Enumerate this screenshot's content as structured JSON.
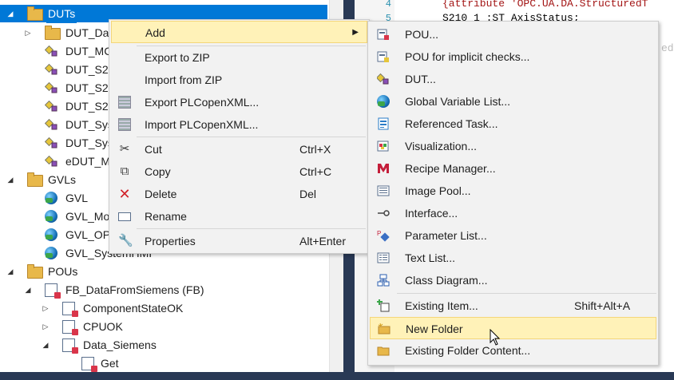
{
  "tree": {
    "items": [
      {
        "label": "DUTs",
        "indent": 0,
        "toggle": "◢",
        "icon": "folder-icon"
      },
      {
        "label": "DUT_Da",
        "indent": 1,
        "toggle": "▷",
        "icon": "folder-icon"
      },
      {
        "label": "DUT_MC",
        "indent": 1,
        "toggle": "",
        "icon": "dut-icon"
      },
      {
        "label": "DUT_S2",
        "indent": 1,
        "toggle": "",
        "icon": "dut-icon"
      },
      {
        "label": "DUT_S2",
        "indent": 1,
        "toggle": "",
        "icon": "dut-icon"
      },
      {
        "label": "DUT_S2",
        "indent": 1,
        "toggle": "",
        "icon": "dut-icon"
      },
      {
        "label": "DUT_Sys",
        "indent": 1,
        "toggle": "",
        "icon": "dut-icon"
      },
      {
        "label": "DUT_Sys",
        "indent": 1,
        "toggle": "",
        "icon": "dut-icon"
      },
      {
        "label": "eDUT_M",
        "indent": 1,
        "toggle": "",
        "icon": "dut-icon"
      },
      {
        "label": "GVLs",
        "indent": 0,
        "toggle": "◢",
        "icon": "folder-icon"
      },
      {
        "label": "GVL",
        "indent": 1,
        "toggle": "",
        "icon": "gvl-icon"
      },
      {
        "label": "GVL_Mo",
        "indent": 1,
        "toggle": "",
        "icon": "gvl-icon"
      },
      {
        "label": "GVL_OP",
        "indent": 1,
        "toggle": "",
        "icon": "gvl-icon"
      },
      {
        "label": "GVL_SystemHMI",
        "indent": 1,
        "toggle": "",
        "icon": "gvl-icon"
      },
      {
        "label": "POUs",
        "indent": 0,
        "toggle": "◢",
        "icon": "folder-icon"
      },
      {
        "label": "FB_DataFromSiemens (FB)",
        "indent": 1,
        "toggle": "◢",
        "icon": "pou-icon"
      },
      {
        "label": "ComponentStateOK",
        "indent": 2,
        "toggle": "▷",
        "icon": "pou-icon"
      },
      {
        "label": "CPUOK",
        "indent": 2,
        "toggle": "▷",
        "icon": "pou-icon"
      },
      {
        "label": "Data_Siemens",
        "indent": 2,
        "toggle": "◢",
        "icon": "pou-icon"
      },
      {
        "label": "Get",
        "indent": 3,
        "toggle": "",
        "icon": "pou-icon"
      }
    ]
  },
  "editor": {
    "line_numbers": [
      "4",
      "5"
    ],
    "lines": [
      "{attribute 'OPC.UA.DA.StructuredT",
      "S210_1  :ST_AxisStatus;"
    ],
    "fragment": "edT"
  },
  "context_menu": {
    "items": [
      {
        "label": "Add",
        "shortcut": "",
        "submenu": true,
        "icon": ""
      },
      {
        "label": "Export to ZIP",
        "shortcut": "",
        "icon": ""
      },
      {
        "label": "Import from ZIP",
        "shortcut": "",
        "icon": ""
      },
      {
        "label": "Export PLCopenXML...",
        "shortcut": "",
        "icon": "export-xml-icon"
      },
      {
        "label": "Import PLCopenXML...",
        "shortcut": "",
        "icon": "import-xml-icon"
      },
      {
        "label": "Cut",
        "shortcut": "Ctrl+X",
        "icon": "scissors-icon"
      },
      {
        "label": "Copy",
        "shortcut": "Ctrl+C",
        "icon": "copy-icon"
      },
      {
        "label": "Delete",
        "shortcut": "Del",
        "icon": "delete-icon"
      },
      {
        "label": "Rename",
        "shortcut": "",
        "icon": "rename-icon"
      },
      {
        "label": "Properties",
        "shortcut": "Alt+Enter",
        "icon": "wrench-icon"
      }
    ]
  },
  "add_submenu": {
    "items": [
      {
        "label": "POU...",
        "shortcut": "",
        "icon": "pou-icon"
      },
      {
        "label": "POU for implicit checks...",
        "shortcut": "",
        "icon": "pou-checks-icon"
      },
      {
        "label": "DUT...",
        "shortcut": "",
        "icon": "dut-icon"
      },
      {
        "label": "Global Variable List...",
        "shortcut": "",
        "icon": "globe-icon"
      },
      {
        "label": "Referenced Task...",
        "shortcut": "",
        "icon": "task-icon"
      },
      {
        "label": "Visualization...",
        "shortcut": "",
        "icon": "visualization-icon"
      },
      {
        "label": "Recipe Manager...",
        "shortcut": "",
        "icon": "recipe-icon"
      },
      {
        "label": "Image Pool...",
        "shortcut": "",
        "icon": "image-pool-icon"
      },
      {
        "label": "Interface...",
        "shortcut": "",
        "icon": "interface-icon"
      },
      {
        "label": "Parameter List...",
        "shortcut": "",
        "icon": "parameter-icon"
      },
      {
        "label": "Text List...",
        "shortcut": "",
        "icon": "text-list-icon"
      },
      {
        "label": "Class Diagram...",
        "shortcut": "",
        "icon": "class-diagram-icon"
      },
      {
        "label": "Existing Item...",
        "shortcut": "Shift+Alt+A",
        "icon": "existing-item-icon"
      },
      {
        "label": "New Folder",
        "shortcut": "",
        "icon": "new-folder-icon"
      },
      {
        "label": "Existing Folder Content...",
        "shortcut": "",
        "icon": "folder-icon"
      }
    ],
    "highlighted": "New Folder"
  },
  "colors": {
    "selection": "#0078d7",
    "menu_bg": "#f2f2f2",
    "highlight": "#fff2b8",
    "frame": "#293955"
  }
}
